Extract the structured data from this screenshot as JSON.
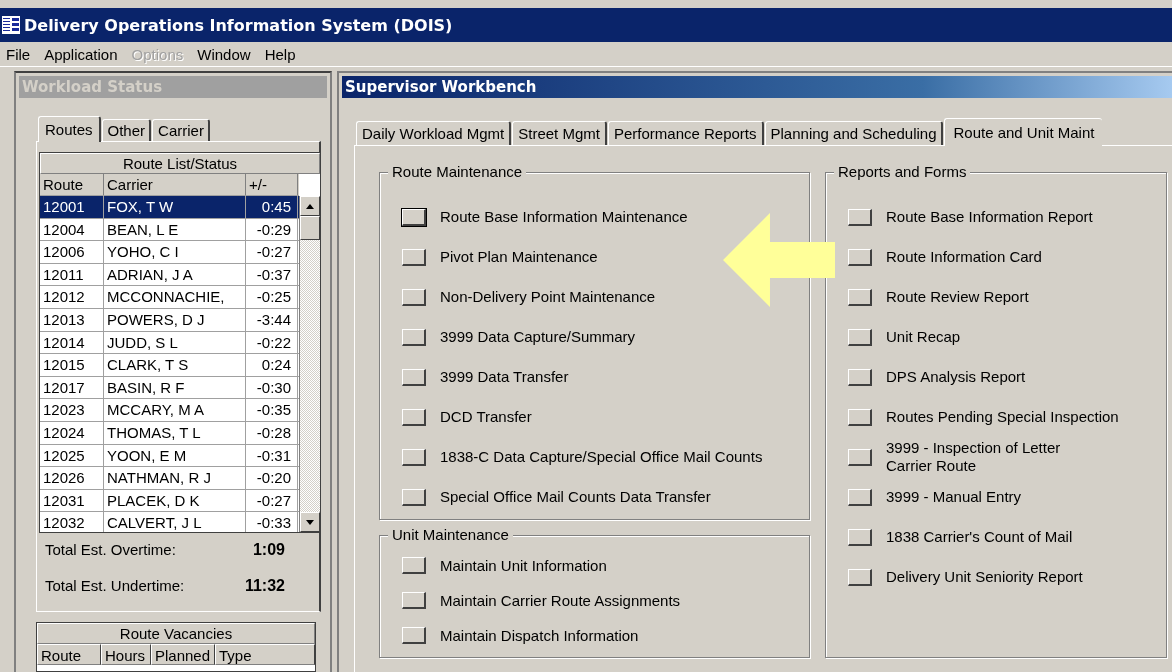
{
  "window": {
    "title": "Delivery Operations Information System (DOIS)"
  },
  "menu": [
    {
      "label": "File",
      "disabled": false
    },
    {
      "label": "Application",
      "disabled": false
    },
    {
      "label": "Options",
      "disabled": true
    },
    {
      "label": "Window",
      "disabled": false
    },
    {
      "label": "Help",
      "disabled": false
    }
  ],
  "workload_status": {
    "title": "Workload Status",
    "tabs": [
      {
        "label": "Routes",
        "selected": true
      },
      {
        "label": "Other",
        "selected": false
      },
      {
        "label": "Carrier",
        "selected": false
      }
    ],
    "route_list": {
      "title": "Route List/Status",
      "columns": [
        "Route",
        "Carrier",
        "+/-"
      ],
      "rows": [
        {
          "route": "12001",
          "carrier": "FOX, T W",
          "diff": "0:45",
          "selected": true
        },
        {
          "route": "12004",
          "carrier": "BEAN, L E",
          "diff": "-0:29",
          "selected": false
        },
        {
          "route": "12006",
          "carrier": "YOHO, C I",
          "diff": "-0:27",
          "selected": false
        },
        {
          "route": "12011",
          "carrier": "ADRIAN, J A",
          "diff": "-0:37",
          "selected": false
        },
        {
          "route": "12012",
          "carrier": "MCCONNACHIE,",
          "diff": "-0:25",
          "selected": false
        },
        {
          "route": "12013",
          "carrier": "POWERS, D J",
          "diff": "-3:44",
          "selected": false
        },
        {
          "route": "12014",
          "carrier": "JUDD, S L",
          "diff": "-0:22",
          "selected": false
        },
        {
          "route": "12015",
          "carrier": "CLARK, T S",
          "diff": "0:24",
          "selected": false
        },
        {
          "route": "12017",
          "carrier": "BASIN, R F",
          "diff": "-0:30",
          "selected": false
        },
        {
          "route": "12023",
          "carrier": "MCCARY, M A",
          "diff": "-0:35",
          "selected": false
        },
        {
          "route": "12024",
          "carrier": "THOMAS, T L",
          "diff": "-0:28",
          "selected": false
        },
        {
          "route": "12025",
          "carrier": "YOON, E M",
          "diff": "-0:31",
          "selected": false
        },
        {
          "route": "12026",
          "carrier": "NATHMAN, R J",
          "diff": "-0:20",
          "selected": false
        },
        {
          "route": "12031",
          "carrier": "PLACEK, D K",
          "diff": "-0:27",
          "selected": false
        },
        {
          "route": "12032",
          "carrier": "CALVERT, J L",
          "diff": "-0:33",
          "selected": false
        }
      ]
    },
    "totals": [
      {
        "label": "Total Est. Overtime:",
        "value": "1:09"
      },
      {
        "label": "Total Est. Undertime:",
        "value": "11:32"
      }
    ],
    "vacancies": {
      "title": "Route Vacancies",
      "columns": [
        "Route",
        "Hours",
        "Planned",
        "Type"
      ]
    }
  },
  "workbench": {
    "title": "Supervisor Workbench",
    "tabs": [
      {
        "label": "Daily Workload Mgmt",
        "selected": false
      },
      {
        "label": "Street Mgmt",
        "selected": false
      },
      {
        "label": "Performance Reports",
        "selected": false
      },
      {
        "label": "Planning and Scheduling",
        "selected": false
      },
      {
        "label": "Route and Unit Maint",
        "selected": true
      }
    ],
    "groups": [
      {
        "title": "Route Maintenance",
        "items": [
          {
            "label": "Route Base Information Maintenance",
            "focused": true
          },
          {
            "label": "Pivot Plan Maintenance",
            "focused": false
          },
          {
            "label": "Non-Delivery Point Maintenance",
            "focused": false
          },
          {
            "label": "3999 Data Capture/Summary",
            "focused": false
          },
          {
            "label": "3999 Data Transfer",
            "focused": false
          },
          {
            "label": "DCD Transfer",
            "focused": false
          },
          {
            "label": "1838-C Data Capture/Special Office Mail Counts",
            "focused": false
          },
          {
            "label": "Special Office Mail Counts Data Transfer",
            "focused": false
          }
        ]
      },
      {
        "title": "Unit Maintenance",
        "items": [
          {
            "label": "Maintain Unit Information",
            "focused": false
          },
          {
            "label": "Maintain Carrier Route Assignments",
            "focused": false
          },
          {
            "label": "Maintain Dispatch Information",
            "focused": false
          }
        ]
      },
      {
        "title": "Reports and Forms",
        "items": [
          {
            "label": "Route Base Information Report",
            "focused": false
          },
          {
            "label": "Route Information Card",
            "focused": false
          },
          {
            "label": "Route Review Report",
            "focused": false
          },
          {
            "label": "Unit Recap",
            "focused": false
          },
          {
            "label": "DPS Analysis Report",
            "focused": false
          },
          {
            "label": "Routes Pending Special Inspection",
            "focused": false
          },
          {
            "label": "3999 - Inspection of Letter Carrier Route",
            "focused": false
          },
          {
            "label": "3999 - Manual Entry",
            "focused": false
          },
          {
            "label": "1838 Carrier's Count of Mail",
            "focused": false
          },
          {
            "label": "Delivery Unit Seniority Report",
            "focused": false
          }
        ]
      }
    ]
  }
}
